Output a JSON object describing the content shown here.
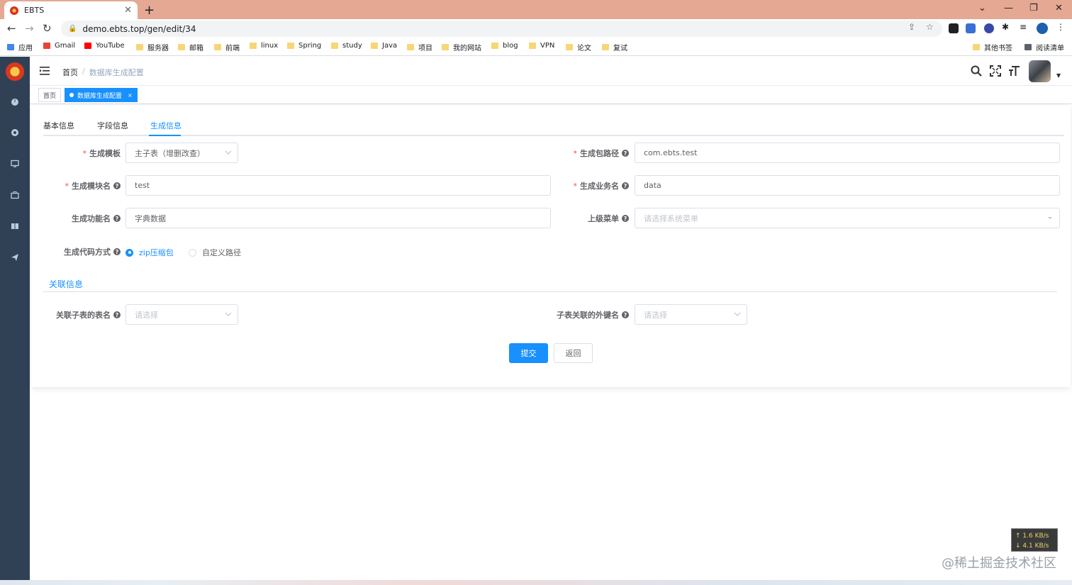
{
  "browser": {
    "tab_title": "EBTS",
    "url": "demo.ebts.top/gen/edit/34",
    "bookmarks": [
      "应用",
      "Gmail",
      "YouTube",
      "服务器",
      "邮箱",
      "前端",
      "linux",
      "Spring",
      "study",
      "Java",
      "项目",
      "我的网站",
      "blog",
      "VPN",
      "论文",
      "复试"
    ],
    "other_bookmarks": "其他书签",
    "reading_list": "阅读清单"
  },
  "navbar": {
    "breadcrumb_home": "首页",
    "breadcrumb_sep": "/",
    "breadcrumb_current": "数据库生成配置"
  },
  "tagsview": {
    "home": "首页",
    "active": "数据库生成配置",
    "close": "×"
  },
  "tabs": {
    "basic": "基本信息",
    "fields": "字段信息",
    "gen": "生成信息"
  },
  "form": {
    "tpl_label": "生成模板",
    "tpl_value": "主子表（增删改查）",
    "package_label": "生成包路径",
    "package_value": "com.ebts.test",
    "module_label": "生成模块名",
    "module_value": "test",
    "business_label": "生成业务名",
    "business_value": "data",
    "function_label": "生成功能名",
    "function_value": "字典数据",
    "parent_menu_label": "上级菜单",
    "parent_menu_placeholder": "请选择系统菜单",
    "gen_type_label": "生成代码方式",
    "gen_type_zip": "zip压缩包",
    "gen_type_custom": "自定义路径",
    "required_mark": "*",
    "help_mark": "?"
  },
  "relation": {
    "title": "关联信息",
    "sub_table_label": "关联子表的表名",
    "sub_table_placeholder": "请选择",
    "fk_label": "子表关联的外键名",
    "fk_placeholder": "请选择"
  },
  "buttons": {
    "submit": "提交",
    "back": "返回"
  },
  "overlay": {
    "up_speed": "↑ 1.6 KB/s",
    "down_speed": "↓ 4.1 KB/s",
    "watermark": "@稀土掘金技术社区"
  },
  "colors": {
    "primary": "#1890ff",
    "sidebar": "#304156",
    "required": "#ff4949"
  }
}
